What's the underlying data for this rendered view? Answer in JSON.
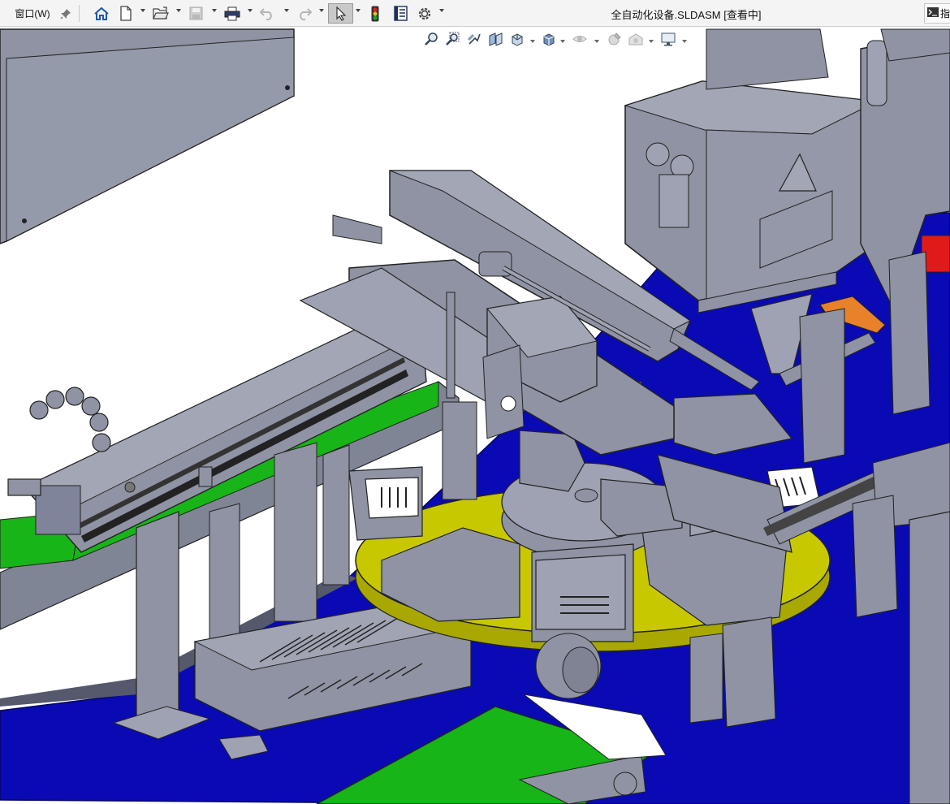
{
  "menu": {
    "window_label": "窗口(W)"
  },
  "toolbar": {
    "buttons": [
      "pin-icon",
      "home-icon",
      "new-document-icon",
      "open-folder-icon",
      "save-icon",
      "print-icon",
      "undo-icon",
      "redo-icon",
      "select-cursor-icon",
      "rebuild-traffic-light-icon",
      "file-properties-icon",
      "options-gear-icon"
    ]
  },
  "document": {
    "title": "全自动化设备.SLDASM [查看中]"
  },
  "command_search": {
    "label": "指"
  },
  "heads_up_toolbar": {
    "buttons": [
      "zoom-to-fit-icon",
      "zoom-to-area-icon",
      "previous-view-icon",
      "section-view-icon",
      "view-orientation-icon",
      "display-style-icon",
      "hide-show-items-icon",
      "edit-appearance-icon",
      "apply-scene-icon",
      "view-settings-icon"
    ]
  },
  "colors": {
    "part_gray": "#8f93a3",
    "base_blue": "#0a0ab4",
    "turntable_yellow": "#c8c800",
    "conveyor_green": "#17b517",
    "accent_red": "#e01a1a",
    "accent_orange": "#e8822a"
  }
}
